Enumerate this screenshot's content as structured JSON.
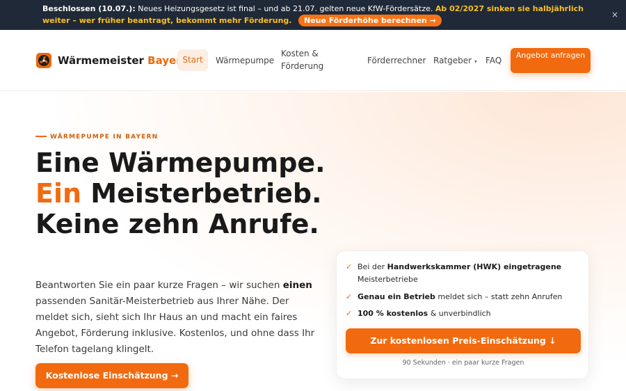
{
  "announcement": {
    "prefix": "Beschlossen (10.07.):",
    "text": " Neues Heizungsgesetz ist final – und ab 21.07. gelten neue KfW-Fördersätze. ",
    "highlight": "Ab 02/2027 sinken sie halbjährlich weiter – wer früher beantragt, bekommt mehr Förderung.",
    "cta": "Neue Förderhöhe berechnen →",
    "close": "×"
  },
  "header": {
    "brand_main": "Wärmemeister ",
    "brand_accent": "Bayern",
    "nav": {
      "start": "Start",
      "waermepumpe": "Wärmepumpe",
      "kosten": "Kosten & Förderung",
      "rechner": "Förderrechner",
      "ratgeber": "Ratgeber",
      "ratgeber_caret": "▾",
      "faq": "FAQ"
    },
    "cta": "Angebot anfragen"
  },
  "hero": {
    "eyebrow": "WÄRMEPUMPE IN BAYERN",
    "headline_1": "Eine Wärmepumpe. ",
    "headline_accent": "Ein",
    "headline_2": " Meisterbetrieb. Keine zehn Anrufe.",
    "lead_1": "Beantworten Sie ein paar kurze Fragen – wir suchen ",
    "lead_bold": "einen",
    "lead_2": " passenden Sanitär-Meisterbetrieb aus Ihrer Nähe. Der meldet sich, sieht sich Ihr Haus an und macht ein faires Angebot, Förderung inklusive. Kostenlos, und ohne dass Ihr Telefon tagelang klingelt.",
    "cta": "Kostenlose Einschätzung →"
  },
  "card": {
    "f1_pre": "Bei der ",
    "f1_bold": "Handwerkskammer (HWK) eingetragene",
    "f1_post": " Meisterbetriebe",
    "f2_bold": "Genau ein Betrieb",
    "f2_post": " meldet sich – statt zehn Anrufen",
    "f3_bold": "100 % kostenlos",
    "f3_post": " & unverbindlich",
    "check": "✓",
    "cta": "Zur kostenlosen Preis-Einschätzung ↓",
    "note": "90 Sekunden · ein paar kurze Fragen"
  },
  "colors": {
    "accent": "#f26a0f",
    "topbar_bg": "#1f2937",
    "highlight": "#fbbf24"
  },
  "icons": {
    "logo": "fan-logo-icon"
  }
}
